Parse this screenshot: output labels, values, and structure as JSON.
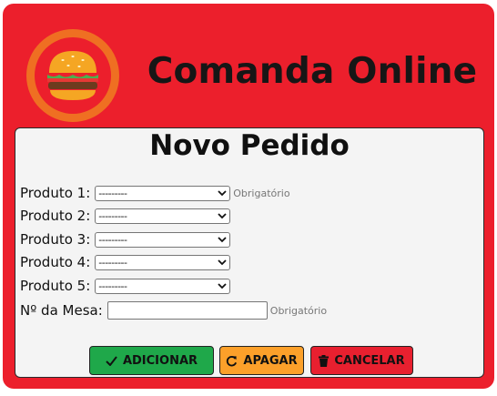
{
  "header": {
    "title": "Comanda Online",
    "logo_icon": "hamburger-icon",
    "colors": {
      "background": "#ec1f2c",
      "logo_ring": "#ef6f22"
    }
  },
  "form": {
    "title": "Novo Pedido",
    "products": [
      {
        "label": "Produto 1:",
        "value": "---------",
        "required_hint": "Obrigatório"
      },
      {
        "label": "Produto 2:",
        "value": "---------",
        "required_hint": ""
      },
      {
        "label": "Produto 3:",
        "value": "---------",
        "required_hint": ""
      },
      {
        "label": "Produto 4:",
        "value": "---------",
        "required_hint": ""
      },
      {
        "label": "Produto 5:",
        "value": "---------",
        "required_hint": ""
      }
    ],
    "table": {
      "label": "Nº da Mesa:",
      "value": "",
      "required_hint": "Obrigatório"
    },
    "buttons": {
      "add": {
        "label": "ADICIONAR",
        "icon": "check-icon",
        "color": "#1fa84a"
      },
      "clear": {
        "label": "APAGAR",
        "icon": "refresh-icon",
        "color": "#fca02a"
      },
      "cancel": {
        "label": "CANCELAR",
        "icon": "trash-icon",
        "color": "#e8202f"
      }
    }
  }
}
